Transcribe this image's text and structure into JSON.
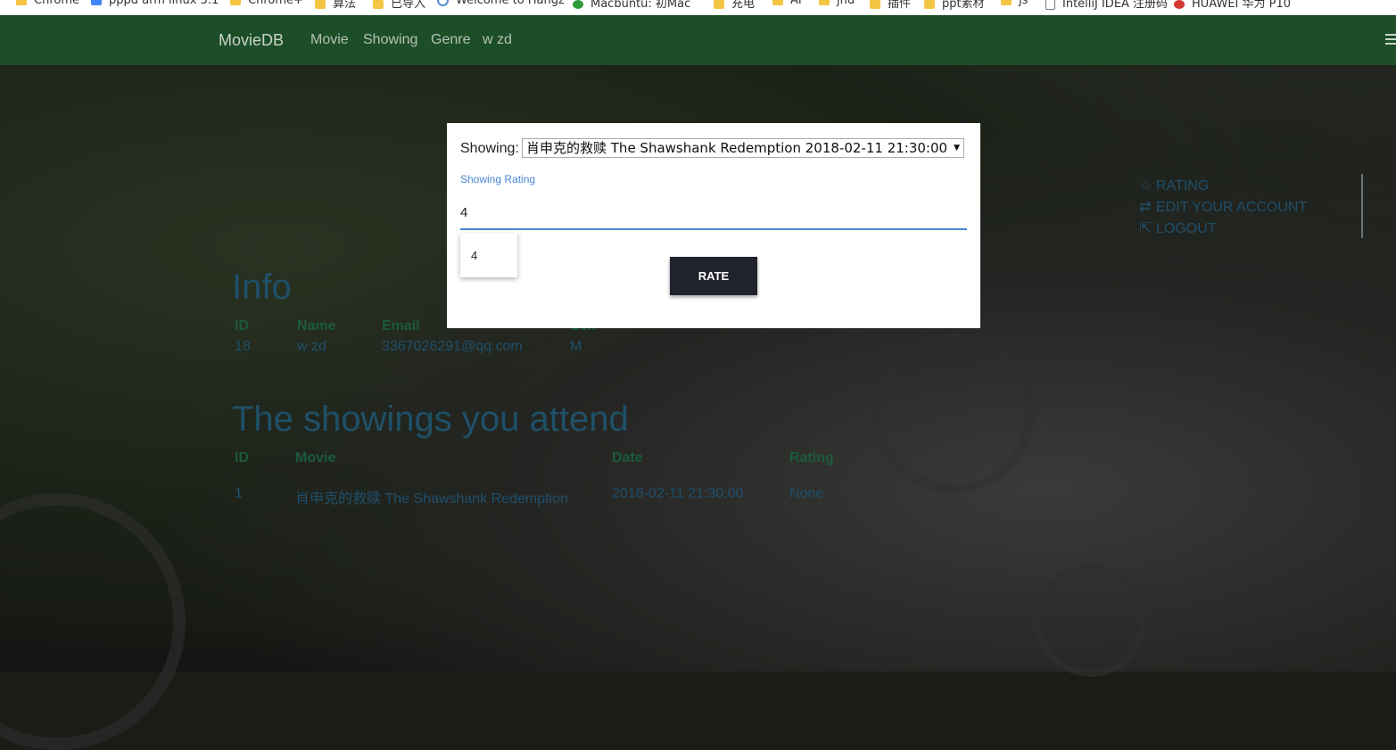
{
  "bookmarks": [
    {
      "label": "Chrome",
      "icon": "folder-icon"
    },
    {
      "label": "pppd arm linux 3.1",
      "icon": "document-icon"
    },
    {
      "label": "Chrome+",
      "icon": "folder-icon"
    },
    {
      "label": "算法",
      "icon": "folder-icon"
    },
    {
      "label": "已导入",
      "icon": "folder-icon"
    },
    {
      "label": "Welcome to Hangz",
      "icon": "globe-icon"
    },
    {
      "label": "Macbuntu: 初Mac",
      "icon": "app-icon"
    },
    {
      "label": "充电",
      "icon": "folder-icon"
    },
    {
      "label": "AI",
      "icon": "folder-icon"
    },
    {
      "label": "jnu",
      "icon": "folder-icon"
    },
    {
      "label": "插件",
      "icon": "folder-icon"
    },
    {
      "label": "ppt素材",
      "icon": "folder-icon"
    },
    {
      "label": "js",
      "icon": "folder-icon"
    },
    {
      "label": "IntelliJ IDEA 注册码",
      "icon": "document-icon"
    },
    {
      "label": "HUAWEI 华为 P10",
      "icon": "huawei-icon"
    }
  ],
  "navbar": {
    "brand": "MovieDB",
    "links": [
      "Movie",
      "Showing",
      "Genre",
      "w zd"
    ]
  },
  "info": {
    "title": "Info",
    "headers": [
      "ID",
      "Name",
      "Email",
      "Sex"
    ],
    "row": [
      "18",
      "w zd",
      "3367026291@qq.com",
      "M"
    ]
  },
  "showings": {
    "title": "The showings you attend",
    "headers": [
      "ID",
      "Movie",
      "Date",
      "Rating"
    ],
    "rows": [
      [
        "1",
        "肖申克的救赎 The Shawshank Redemption",
        "2018-02-11 21:30:00",
        "None"
      ]
    ]
  },
  "side_menu": {
    "rating": "RATING",
    "edit_account": "EDIT YOUR ACCOUNT",
    "logout": "LOGOUT"
  },
  "modal": {
    "showing_label": "Showing:",
    "showing_selected": "肖申克的救赎 The Shawshank Redemption 2018-02-11 21:30:00",
    "rating_label": "Showing Rating",
    "rating_value": "4",
    "autocomplete_option": "4",
    "rate_button": "RATE"
  },
  "colors": {
    "navbar": "#1c4e28",
    "accent_blue": "#4a86d6",
    "button_dark": "#20232c"
  }
}
